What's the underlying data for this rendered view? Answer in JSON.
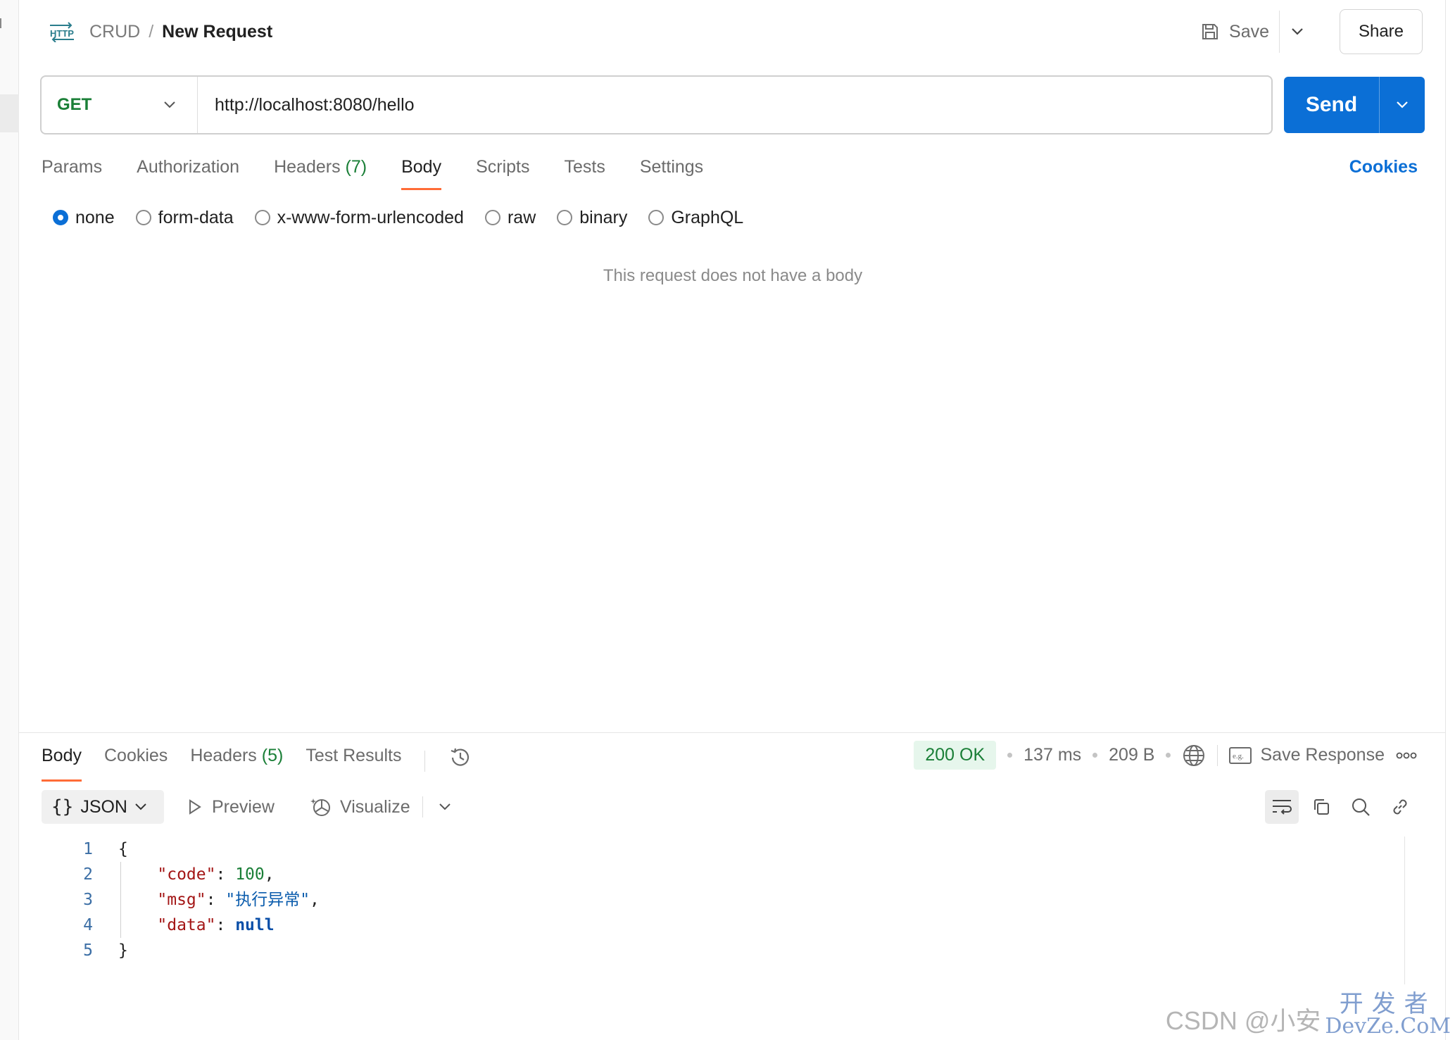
{
  "header": {
    "collection": "CRUD",
    "separator": "/",
    "request_name": "New Request",
    "save_label": "Save",
    "share_label": "Share"
  },
  "request": {
    "method": "GET",
    "url": "http://localhost:8080/hello",
    "send_label": "Send",
    "tabs": [
      {
        "label": "Params"
      },
      {
        "label": "Authorization"
      },
      {
        "label": "Headers",
        "count": "(7)"
      },
      {
        "label": "Body",
        "active": true
      },
      {
        "label": "Scripts"
      },
      {
        "label": "Tests"
      },
      {
        "label": "Settings"
      }
    ],
    "cookies_label": "Cookies",
    "body_types": [
      "none",
      "form-data",
      "x-www-form-urlencoded",
      "raw",
      "binary",
      "GraphQL"
    ],
    "selected_body_type": "none",
    "empty_body_message": "This request does not have a body"
  },
  "response": {
    "tabs": [
      {
        "label": "Body",
        "active": true
      },
      {
        "label": "Cookies"
      },
      {
        "label": "Headers",
        "count": "(5)"
      },
      {
        "label": "Test Results"
      }
    ],
    "status": "200 OK",
    "time": "137 ms",
    "size": "209 B",
    "save_response_label": "Save Response",
    "format": "JSON",
    "preview_label": "Preview",
    "visualize_label": "Visualize",
    "code_lines": [
      {
        "n": "1",
        "text": "{"
      },
      {
        "n": "2",
        "key": "\"code\"",
        "value": "100",
        "vtype": "number",
        "trail": ","
      },
      {
        "n": "3",
        "key": "\"msg\"",
        "value": "\"执行异常\"",
        "vtype": "string",
        "trail": ","
      },
      {
        "n": "4",
        "key": "\"data\"",
        "value": "null",
        "vtype": "null",
        "trail": ""
      },
      {
        "n": "5",
        "text": "}"
      }
    ]
  },
  "watermark": {
    "left": "CSDN @小安",
    "cn": "开发者",
    "en": "DevZe.CoM"
  },
  "colors": {
    "accent_blue": "#0b6fd6",
    "method_green": "#1a7f37",
    "tab_underline": "#ff6c37",
    "status_bg": "#e6f6ec"
  }
}
